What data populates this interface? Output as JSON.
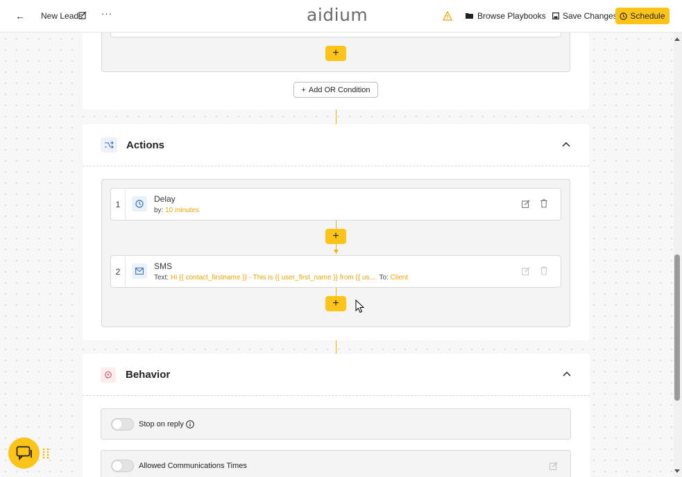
{
  "topbar": {
    "title": "New Leads",
    "logo_text": "aidium",
    "browse_label": "Browse Playbooks",
    "save_label": "Save Changes",
    "schedule_label": "Schedule"
  },
  "conditions": {
    "add_or_label": "Add OR Condition"
  },
  "actions": {
    "title": "Actions",
    "items": [
      {
        "index": "1",
        "name": "Delay",
        "detail_prefix": "by:",
        "detail_value": "10 minutes"
      },
      {
        "index": "2",
        "name": "SMS",
        "detail_prefix": "Text:",
        "detail_value": "Hi {{ contact_firstname }} - This is {{ user_first_name }} from {{ us...",
        "to_prefix": "To:",
        "to_value": "Client"
      }
    ]
  },
  "behavior": {
    "title": "Behavior",
    "stop_on_reply_label": "Stop on reply",
    "allowed_times_label": "Allowed Communications Times"
  },
  "colors": {
    "accent": "#fcc419",
    "highlight_text": "#f0a500"
  }
}
